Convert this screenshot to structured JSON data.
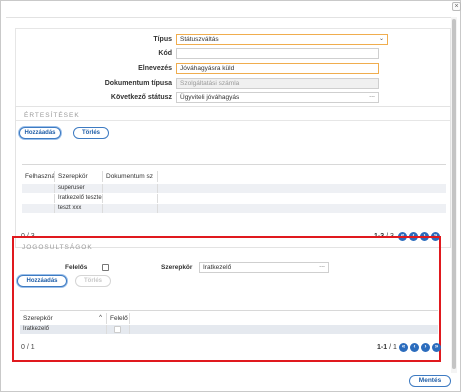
{
  "window": {
    "close_icon": "×"
  },
  "form": {
    "tipus": {
      "label": "Típus",
      "value": "Státuszváltás"
    },
    "kod": {
      "label": "Kód",
      "value": ""
    },
    "elnevezes": {
      "label": "Elnevezés",
      "value": "Jóváhagyásra küld"
    },
    "dokumentum_tipusa": {
      "label": "Dokumentum típusa",
      "value": "Szolgáltatási számla"
    },
    "kovetkezo_statusz": {
      "label": "Következő státusz",
      "value": "Ügyviteli jóváhagyás"
    }
  },
  "ertesitesek": {
    "title": "ÉRTESÍTÉSEK",
    "add_label": "Hozzáadás",
    "delete_label": "Törlés",
    "columns": [
      "Felhaszná",
      "Szerepkör",
      "Dokumentum sz"
    ],
    "rows": [
      {
        "felhasznalo": "",
        "szerepkor": "superuser",
        "dokumentum": ""
      },
      {
        "felhasznalo": "",
        "szerepkor": "Iratkezelő tesztelé",
        "dokumentum": ""
      },
      {
        "felhasznalo": "",
        "szerepkor": "teszt xxx",
        "dokumentum": ""
      }
    ],
    "pager": {
      "left": "0  /  3",
      "range": "1-3",
      "total": " / 3"
    }
  },
  "jogosultsagok": {
    "title": "JOGOSULTSÁGOK",
    "felelos_label": "Felelős",
    "szerepkor_label": "Szerepkör",
    "szerepkor_value": "Iratkezelő",
    "add_label": "Hozzáadás",
    "delete_label": "Törlés",
    "columns": [
      "Szerepkör",
      "Felelő"
    ],
    "rows": [
      {
        "szerepkor": "Iratkezelő"
      }
    ],
    "pager": {
      "left": "0  /  1",
      "range": "1-1",
      "total": " / 1"
    }
  },
  "footer": {
    "save_label": "Mentés"
  },
  "icons": {
    "first": "«",
    "prev": "‹",
    "next": "›",
    "last": "»",
    "dots": "...",
    "chevron": "⌄"
  },
  "colors": {
    "accent": "#2b6cbd",
    "highlight_border": "#e0191e",
    "required_border": "#f0ad4e"
  }
}
